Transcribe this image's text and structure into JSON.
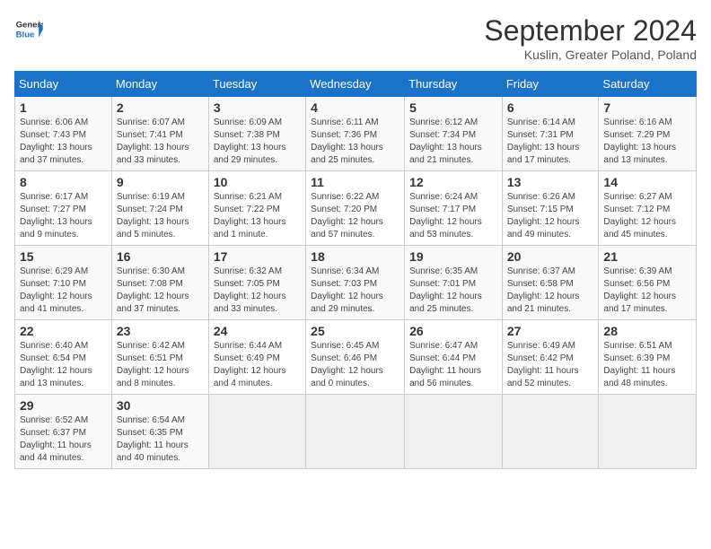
{
  "header": {
    "logo_line1": "General",
    "logo_line2": "Blue",
    "month": "September 2024",
    "location": "Kuslin, Greater Poland, Poland"
  },
  "weekdays": [
    "Sunday",
    "Monday",
    "Tuesday",
    "Wednesday",
    "Thursday",
    "Friday",
    "Saturday"
  ],
  "weeks": [
    [
      {
        "day": "1",
        "info": "Sunrise: 6:06 AM\nSunset: 7:43 PM\nDaylight: 13 hours\nand 37 minutes."
      },
      {
        "day": "2",
        "info": "Sunrise: 6:07 AM\nSunset: 7:41 PM\nDaylight: 13 hours\nand 33 minutes."
      },
      {
        "day": "3",
        "info": "Sunrise: 6:09 AM\nSunset: 7:38 PM\nDaylight: 13 hours\nand 29 minutes."
      },
      {
        "day": "4",
        "info": "Sunrise: 6:11 AM\nSunset: 7:36 PM\nDaylight: 13 hours\nand 25 minutes."
      },
      {
        "day": "5",
        "info": "Sunrise: 6:12 AM\nSunset: 7:34 PM\nDaylight: 13 hours\nand 21 minutes."
      },
      {
        "day": "6",
        "info": "Sunrise: 6:14 AM\nSunset: 7:31 PM\nDaylight: 13 hours\nand 17 minutes."
      },
      {
        "day": "7",
        "info": "Sunrise: 6:16 AM\nSunset: 7:29 PM\nDaylight: 13 hours\nand 13 minutes."
      }
    ],
    [
      {
        "day": "8",
        "info": "Sunrise: 6:17 AM\nSunset: 7:27 PM\nDaylight: 13 hours\nand 9 minutes."
      },
      {
        "day": "9",
        "info": "Sunrise: 6:19 AM\nSunset: 7:24 PM\nDaylight: 13 hours\nand 5 minutes."
      },
      {
        "day": "10",
        "info": "Sunrise: 6:21 AM\nSunset: 7:22 PM\nDaylight: 13 hours\nand 1 minute."
      },
      {
        "day": "11",
        "info": "Sunrise: 6:22 AM\nSunset: 7:20 PM\nDaylight: 12 hours\nand 57 minutes."
      },
      {
        "day": "12",
        "info": "Sunrise: 6:24 AM\nSunset: 7:17 PM\nDaylight: 12 hours\nand 53 minutes."
      },
      {
        "day": "13",
        "info": "Sunrise: 6:26 AM\nSunset: 7:15 PM\nDaylight: 12 hours\nand 49 minutes."
      },
      {
        "day": "14",
        "info": "Sunrise: 6:27 AM\nSunset: 7:12 PM\nDaylight: 12 hours\nand 45 minutes."
      }
    ],
    [
      {
        "day": "15",
        "info": "Sunrise: 6:29 AM\nSunset: 7:10 PM\nDaylight: 12 hours\nand 41 minutes."
      },
      {
        "day": "16",
        "info": "Sunrise: 6:30 AM\nSunset: 7:08 PM\nDaylight: 12 hours\nand 37 minutes."
      },
      {
        "day": "17",
        "info": "Sunrise: 6:32 AM\nSunset: 7:05 PM\nDaylight: 12 hours\nand 33 minutes."
      },
      {
        "day": "18",
        "info": "Sunrise: 6:34 AM\nSunset: 7:03 PM\nDaylight: 12 hours\nand 29 minutes."
      },
      {
        "day": "19",
        "info": "Sunrise: 6:35 AM\nSunset: 7:01 PM\nDaylight: 12 hours\nand 25 minutes."
      },
      {
        "day": "20",
        "info": "Sunrise: 6:37 AM\nSunset: 6:58 PM\nDaylight: 12 hours\nand 21 minutes."
      },
      {
        "day": "21",
        "info": "Sunrise: 6:39 AM\nSunset: 6:56 PM\nDaylight: 12 hours\nand 17 minutes."
      }
    ],
    [
      {
        "day": "22",
        "info": "Sunrise: 6:40 AM\nSunset: 6:54 PM\nDaylight: 12 hours\nand 13 minutes."
      },
      {
        "day": "23",
        "info": "Sunrise: 6:42 AM\nSunset: 6:51 PM\nDaylight: 12 hours\nand 8 minutes."
      },
      {
        "day": "24",
        "info": "Sunrise: 6:44 AM\nSunset: 6:49 PM\nDaylight: 12 hours\nand 4 minutes."
      },
      {
        "day": "25",
        "info": "Sunrise: 6:45 AM\nSunset: 6:46 PM\nDaylight: 12 hours\nand 0 minutes."
      },
      {
        "day": "26",
        "info": "Sunrise: 6:47 AM\nSunset: 6:44 PM\nDaylight: 11 hours\nand 56 minutes."
      },
      {
        "day": "27",
        "info": "Sunrise: 6:49 AM\nSunset: 6:42 PM\nDaylight: 11 hours\nand 52 minutes."
      },
      {
        "day": "28",
        "info": "Sunrise: 6:51 AM\nSunset: 6:39 PM\nDaylight: 11 hours\nand 48 minutes."
      }
    ],
    [
      {
        "day": "29",
        "info": "Sunrise: 6:52 AM\nSunset: 6:37 PM\nDaylight: 11 hours\nand 44 minutes."
      },
      {
        "day": "30",
        "info": "Sunrise: 6:54 AM\nSunset: 6:35 PM\nDaylight: 11 hours\nand 40 minutes."
      },
      {
        "day": "",
        "info": ""
      },
      {
        "day": "",
        "info": ""
      },
      {
        "day": "",
        "info": ""
      },
      {
        "day": "",
        "info": ""
      },
      {
        "day": "",
        "info": ""
      }
    ]
  ]
}
